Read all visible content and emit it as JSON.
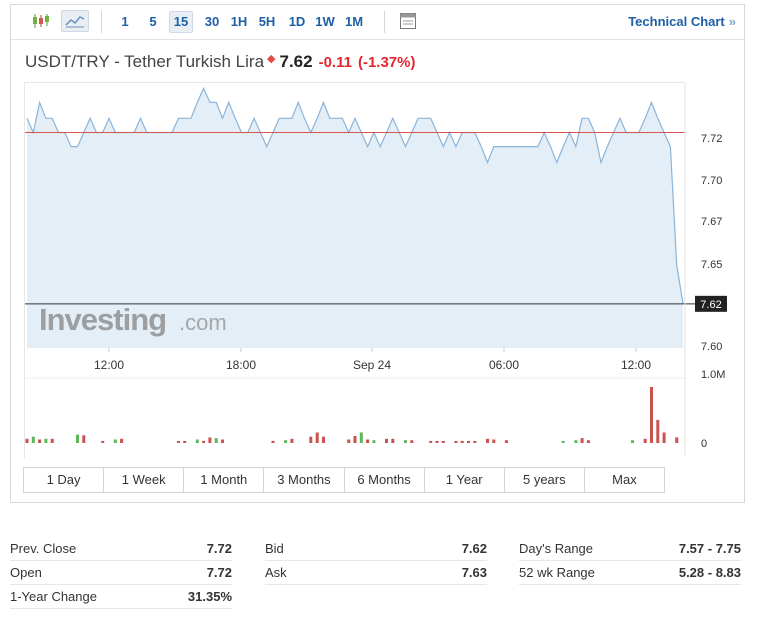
{
  "toolbar": {
    "icons": [
      "candlestick-icon",
      "area-chart-icon",
      "calendar-icon"
    ],
    "timeframes": [
      "1",
      "5",
      "15",
      "30",
      "1H",
      "5H",
      "1D",
      "1W",
      "1M"
    ],
    "selected_timeframe": "15",
    "technical_chart_label": "Technical Chart",
    "technical_chart_arrow": "»"
  },
  "header": {
    "symbol": "USDT/TRY - Tether Turkish Lira",
    "last": "7.62",
    "change": "-0.11",
    "change_pct": "(-1.37%)"
  },
  "watermark": {
    "brand": "Investing",
    "suffix": ".com"
  },
  "range_buttons": [
    "1 Day",
    "1 Week",
    "1 Month",
    "3 Months",
    "6 Months",
    "1 Year",
    "5 years",
    "Max"
  ],
  "colors": {
    "accent": "#1e5fa6",
    "down": "#e5262f",
    "line": "#8ab4d9",
    "area": "#e4eef7",
    "ref_line": "#d9534f",
    "vol_up": "#5cb85c",
    "vol_down": "#c9534f"
  },
  "chart_data": {
    "type": "area",
    "x_ticks": [
      "12:00",
      "18:00",
      "Sep 24",
      "06:00",
      "12:00"
    ],
    "y_ticks": [
      "7.72",
      "7.70",
      "7.67",
      "7.65",
      "7.62",
      "7.60"
    ],
    "current_label": "7.62",
    "ylim": [
      7.595,
      7.745
    ],
    "prev_close": 7.717,
    "values": [
      7.725,
      7.717,
      7.734,
      7.725,
      7.725,
      7.717,
      7.717,
      7.709,
      7.709,
      7.717,
      7.725,
      7.717,
      7.717,
      7.725,
      7.717,
      7.717,
      7.717,
      7.717,
      7.725,
      7.717,
      7.717,
      7.717,
      7.717,
      7.717,
      7.725,
      7.725,
      7.725,
      7.734,
      7.742,
      7.734,
      7.734,
      7.725,
      7.734,
      7.725,
      7.717,
      7.717,
      7.725,
      7.717,
      7.709,
      7.717,
      7.725,
      7.725,
      7.725,
      7.734,
      7.725,
      7.717,
      7.725,
      7.734,
      7.725,
      7.725,
      7.725,
      7.717,
      7.725,
      7.717,
      7.709,
      7.717,
      7.709,
      7.717,
      7.725,
      7.717,
      7.709,
      7.717,
      7.725,
      7.725,
      7.725,
      7.717,
      7.709,
      7.717,
      7.709,
      7.717,
      7.717,
      7.717,
      7.709,
      7.7,
      7.709,
      7.709,
      7.709,
      7.709,
      7.709,
      7.709,
      7.709,
      7.709,
      7.717,
      7.709,
      7.7,
      7.709,
      7.717,
      7.709,
      7.725,
      7.725,
      7.717,
      7.7,
      7.709,
      7.717,
      7.725,
      7.717,
      7.717,
      7.717,
      7.725,
      7.734,
      7.725,
      7.717,
      7.709,
      7.642,
      7.62
    ],
    "volume_ylim": [
      0,
      1000000
    ],
    "volume_ticks": [
      "1.0M",
      "0"
    ],
    "volumes": [
      60000,
      90000,
      50000,
      60000,
      60000,
      0,
      0,
      0,
      120000,
      110000,
      0,
      0,
      30000,
      0,
      50000,
      60000,
      0,
      0,
      0,
      0,
      0,
      0,
      0,
      0,
      30000,
      30000,
      0,
      50000,
      30000,
      80000,
      70000,
      50000,
      0,
      0,
      0,
      0,
      0,
      0,
      0,
      30000,
      0,
      40000,
      60000,
      0,
      0,
      90000,
      150000,
      90000,
      0,
      0,
      0,
      50000,
      100000,
      150000,
      50000,
      40000,
      0,
      60000,
      60000,
      0,
      40000,
      40000,
      0,
      0,
      30000,
      30000,
      30000,
      0,
      30000,
      30000,
      30000,
      30000,
      0,
      60000,
      50000,
      0,
      40000,
      0,
      0,
      0,
      0,
      0,
      0,
      0,
      0,
      30000,
      0,
      40000,
      70000,
      40000,
      0,
      0,
      0,
      0,
      0,
      0,
      40000,
      0,
      60000,
      800000,
      330000,
      150000,
      0,
      80000
    ],
    "volume_up": [
      false,
      true,
      false,
      true,
      false,
      false,
      false,
      false,
      true,
      false,
      false,
      false,
      false,
      false,
      true,
      false,
      false,
      false,
      false,
      false,
      false,
      false,
      false,
      false,
      false,
      false,
      false,
      true,
      false,
      false,
      true,
      false,
      false,
      false,
      false,
      false,
      false,
      false,
      false,
      false,
      false,
      true,
      false,
      false,
      false,
      false,
      false,
      false,
      false,
      false,
      false,
      false,
      false,
      true,
      false,
      true,
      false,
      false,
      false,
      false,
      true,
      false,
      false,
      false,
      false,
      false,
      false,
      false,
      false,
      false,
      false,
      false,
      false,
      false,
      false,
      false,
      false,
      false,
      false,
      false,
      false,
      false,
      false,
      false,
      false,
      true,
      false,
      true,
      false,
      false,
      false,
      false,
      false,
      false,
      false,
      false,
      true,
      false,
      false,
      false,
      false,
      false,
      false,
      false
    ]
  },
  "stats": {
    "col1": [
      {
        "k": "Prev. Close",
        "v": "7.72"
      },
      {
        "k": "Open",
        "v": "7.72"
      },
      {
        "k": "1-Year Change",
        "v": "31.35%"
      }
    ],
    "col2": [
      {
        "k": "Bid",
        "v": "7.62"
      },
      {
        "k": "Ask",
        "v": "7.63"
      }
    ],
    "col3": [
      {
        "k": "Day's Range",
        "v": "7.57 - 7.75"
      },
      {
        "k": "52 wk Range",
        "v": "5.28 - 8.83"
      }
    ]
  }
}
